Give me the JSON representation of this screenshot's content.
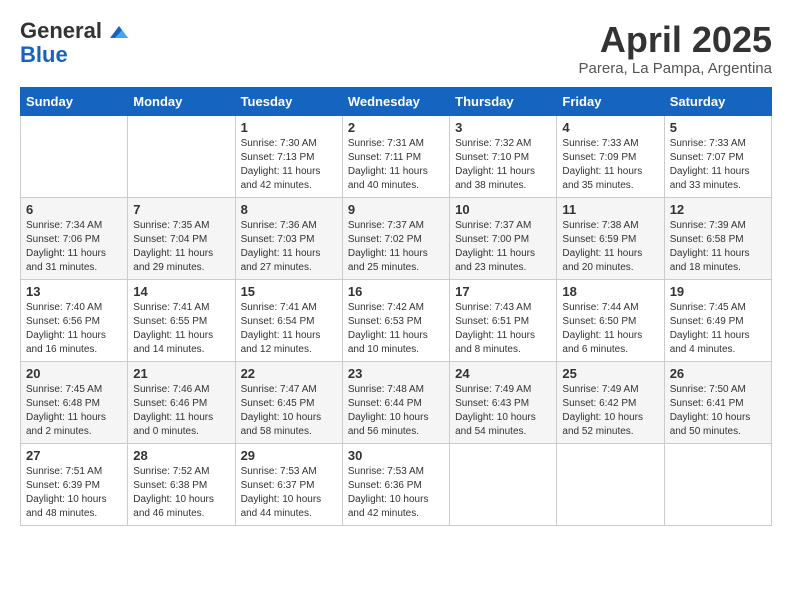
{
  "header": {
    "logo_line1": "General",
    "logo_line2": "Blue",
    "title": "April 2025",
    "subtitle": "Parera, La Pampa, Argentina"
  },
  "calendar": {
    "days_of_week": [
      "Sunday",
      "Monday",
      "Tuesday",
      "Wednesday",
      "Thursday",
      "Friday",
      "Saturday"
    ],
    "weeks": [
      [
        {
          "day": "",
          "info": ""
        },
        {
          "day": "",
          "info": ""
        },
        {
          "day": "1",
          "info": "Sunrise: 7:30 AM\nSunset: 7:13 PM\nDaylight: 11 hours and 42 minutes."
        },
        {
          "day": "2",
          "info": "Sunrise: 7:31 AM\nSunset: 7:11 PM\nDaylight: 11 hours and 40 minutes."
        },
        {
          "day": "3",
          "info": "Sunrise: 7:32 AM\nSunset: 7:10 PM\nDaylight: 11 hours and 38 minutes."
        },
        {
          "day": "4",
          "info": "Sunrise: 7:33 AM\nSunset: 7:09 PM\nDaylight: 11 hours and 35 minutes."
        },
        {
          "day": "5",
          "info": "Sunrise: 7:33 AM\nSunset: 7:07 PM\nDaylight: 11 hours and 33 minutes."
        }
      ],
      [
        {
          "day": "6",
          "info": "Sunrise: 7:34 AM\nSunset: 7:06 PM\nDaylight: 11 hours and 31 minutes."
        },
        {
          "day": "7",
          "info": "Sunrise: 7:35 AM\nSunset: 7:04 PM\nDaylight: 11 hours and 29 minutes."
        },
        {
          "day": "8",
          "info": "Sunrise: 7:36 AM\nSunset: 7:03 PM\nDaylight: 11 hours and 27 minutes."
        },
        {
          "day": "9",
          "info": "Sunrise: 7:37 AM\nSunset: 7:02 PM\nDaylight: 11 hours and 25 minutes."
        },
        {
          "day": "10",
          "info": "Sunrise: 7:37 AM\nSunset: 7:00 PM\nDaylight: 11 hours and 23 minutes."
        },
        {
          "day": "11",
          "info": "Sunrise: 7:38 AM\nSunset: 6:59 PM\nDaylight: 11 hours and 20 minutes."
        },
        {
          "day": "12",
          "info": "Sunrise: 7:39 AM\nSunset: 6:58 PM\nDaylight: 11 hours and 18 minutes."
        }
      ],
      [
        {
          "day": "13",
          "info": "Sunrise: 7:40 AM\nSunset: 6:56 PM\nDaylight: 11 hours and 16 minutes."
        },
        {
          "day": "14",
          "info": "Sunrise: 7:41 AM\nSunset: 6:55 PM\nDaylight: 11 hours and 14 minutes."
        },
        {
          "day": "15",
          "info": "Sunrise: 7:41 AM\nSunset: 6:54 PM\nDaylight: 11 hours and 12 minutes."
        },
        {
          "day": "16",
          "info": "Sunrise: 7:42 AM\nSunset: 6:53 PM\nDaylight: 11 hours and 10 minutes."
        },
        {
          "day": "17",
          "info": "Sunrise: 7:43 AM\nSunset: 6:51 PM\nDaylight: 11 hours and 8 minutes."
        },
        {
          "day": "18",
          "info": "Sunrise: 7:44 AM\nSunset: 6:50 PM\nDaylight: 11 hours and 6 minutes."
        },
        {
          "day": "19",
          "info": "Sunrise: 7:45 AM\nSunset: 6:49 PM\nDaylight: 11 hours and 4 minutes."
        }
      ],
      [
        {
          "day": "20",
          "info": "Sunrise: 7:45 AM\nSunset: 6:48 PM\nDaylight: 11 hours and 2 minutes."
        },
        {
          "day": "21",
          "info": "Sunrise: 7:46 AM\nSunset: 6:46 PM\nDaylight: 11 hours and 0 minutes."
        },
        {
          "day": "22",
          "info": "Sunrise: 7:47 AM\nSunset: 6:45 PM\nDaylight: 10 hours and 58 minutes."
        },
        {
          "day": "23",
          "info": "Sunrise: 7:48 AM\nSunset: 6:44 PM\nDaylight: 10 hours and 56 minutes."
        },
        {
          "day": "24",
          "info": "Sunrise: 7:49 AM\nSunset: 6:43 PM\nDaylight: 10 hours and 54 minutes."
        },
        {
          "day": "25",
          "info": "Sunrise: 7:49 AM\nSunset: 6:42 PM\nDaylight: 10 hours and 52 minutes."
        },
        {
          "day": "26",
          "info": "Sunrise: 7:50 AM\nSunset: 6:41 PM\nDaylight: 10 hours and 50 minutes."
        }
      ],
      [
        {
          "day": "27",
          "info": "Sunrise: 7:51 AM\nSunset: 6:39 PM\nDaylight: 10 hours and 48 minutes."
        },
        {
          "day": "28",
          "info": "Sunrise: 7:52 AM\nSunset: 6:38 PM\nDaylight: 10 hours and 46 minutes."
        },
        {
          "day": "29",
          "info": "Sunrise: 7:53 AM\nSunset: 6:37 PM\nDaylight: 10 hours and 44 minutes."
        },
        {
          "day": "30",
          "info": "Sunrise: 7:53 AM\nSunset: 6:36 PM\nDaylight: 10 hours and 42 minutes."
        },
        {
          "day": "",
          "info": ""
        },
        {
          "day": "",
          "info": ""
        },
        {
          "day": "",
          "info": ""
        }
      ]
    ]
  }
}
